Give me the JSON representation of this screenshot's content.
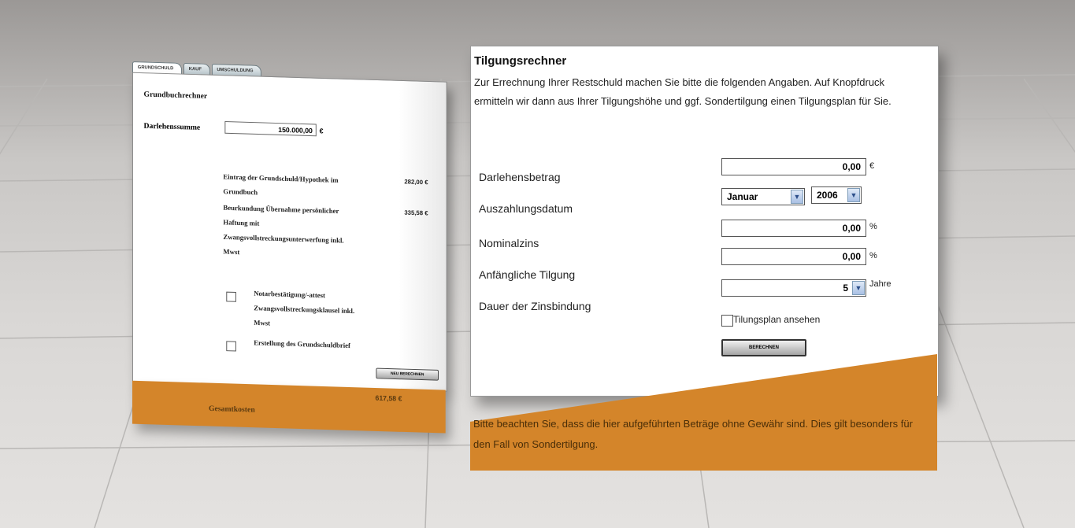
{
  "left_panel": {
    "tabs": [
      "GRUNDSCHULD",
      "KAUF",
      "UMSCHULDUNG"
    ],
    "title": "Grundbuchrechner",
    "loan_label": "Darlehenssumme",
    "loan_value": "150.000,00",
    "currency": "€",
    "fees": [
      {
        "label_lines": [
          "Eintrag der Grundschuld/Hypothek im",
          "Grundbuch"
        ],
        "amount": "282,00 €"
      },
      {
        "label_lines": [
          "Beurkundung Übernahme persönlicher",
          "Haftung mit",
          "Zwangsvollstreckungsunterwerfung inkl.",
          "Mwst"
        ],
        "amount": "335,58 €"
      }
    ],
    "options": [
      {
        "label_lines": [
          "Notarbestätigung/-attest",
          "Zwangsvollstreckungsklausel inkl.",
          "Mwst"
        ],
        "checked": false
      },
      {
        "label_lines": [
          "Erstellung des Grundschuldbrief"
        ],
        "checked": false
      }
    ],
    "recalc_button": "NEU BERECHNEN",
    "total_label": "Gesamtkosten",
    "total_value": "617,58 €"
  },
  "right_panel": {
    "title": "Tilgungsrechner",
    "description": "Zur Errechnung Ihrer Restschuld machen Sie bitte die folgenden Angaben. Auf Knopfdruck ermitteln wir dann aus Ihrer Tilgungshöhe und ggf. Sondertilgung einen Tilgungsplan für Sie.",
    "fields": {
      "darlehensbetrag": {
        "label": "Darlehensbetrag",
        "value": "0,00",
        "suffix": "€"
      },
      "auszahlungsdatum": {
        "label": "Auszahlungsdatum",
        "month": "Januar",
        "year": "2006"
      },
      "nominalzins": {
        "label": "Nominalzins",
        "value": "0,00",
        "suffix": "%"
      },
      "tilgung": {
        "label": "Anfängliche Tilgung",
        "value": "0,00",
        "suffix": "%"
      },
      "zinsbindung": {
        "label": "Dauer der Zinsbindung",
        "value": "5",
        "suffix": "Jahre"
      }
    },
    "plan_checkbox_label": "Tilungsplan ansehen",
    "calc_button": "BERECHNEN",
    "footer_note": "Bitte beachten Sie, dass die hier aufgeführten Beträge ohne Gewähr sind. Dies gilt besonders für den Fall von Sondertilgung."
  },
  "colors": {
    "accent_orange": "#d4852a",
    "floor": "#d9d7d5"
  }
}
